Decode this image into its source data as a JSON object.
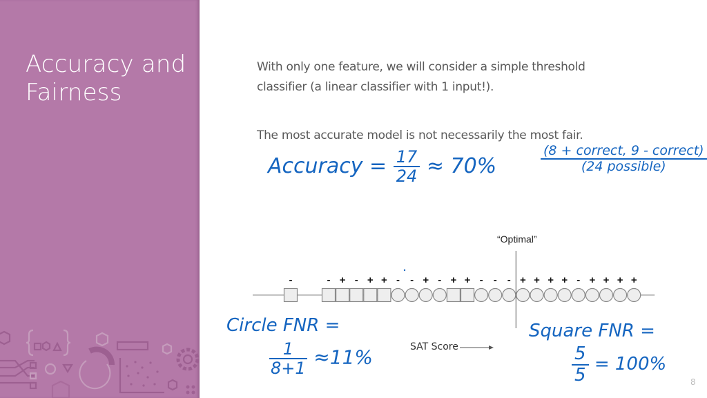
{
  "sidebar": {
    "title_line1": "Accuracy and",
    "title_line2": "Fairness",
    "color": "#b479a8"
  },
  "body": {
    "paragraph1_line1": "With only one feature, we will consider a simple threshold",
    "paragraph1_line2": "classifier (a linear classifier with 1 input!).",
    "paragraph2": "The most accurate model is not necessarily the most fair."
  },
  "annotations": {
    "ink_color": "#1565c0",
    "accuracy_label": "Accuracy =",
    "accuracy_numerator": "17",
    "accuracy_denominator": "24",
    "accuracy_result": "≈ 70%",
    "correct_note_numerator": "(8 + correct, 9 - correct)",
    "correct_note_denominator": "(24 possible)",
    "circle_fnr_label": "Circle FNR =",
    "circle_fnr_numerator": "1",
    "circle_fnr_denominator": "8+1",
    "circle_fnr_result": "≈11%",
    "square_fnr_label": "Square FNR =",
    "square_fnr_numerator": "5",
    "square_fnr_denominator": "5",
    "square_fnr_result": "= 100%"
  },
  "number_line": {
    "threshold_label": "“Optimal”",
    "axis_label": "SAT Score",
    "threshold_after_index": 14,
    "points": [
      {
        "shape": "square",
        "label": "-"
      },
      {
        "shape": "square",
        "label": "-"
      },
      {
        "shape": "square",
        "label": "+"
      },
      {
        "shape": "square",
        "label": "-"
      },
      {
        "shape": "square",
        "label": "+"
      },
      {
        "shape": "square",
        "label": "+"
      },
      {
        "shape": "circle",
        "label": "-"
      },
      {
        "shape": "circle",
        "label": "-"
      },
      {
        "shape": "circle",
        "label": "+"
      },
      {
        "shape": "circle",
        "label": "-"
      },
      {
        "shape": "square",
        "label": "+"
      },
      {
        "shape": "square",
        "label": "+"
      },
      {
        "shape": "circle",
        "label": "-"
      },
      {
        "shape": "circle",
        "label": "-"
      },
      {
        "shape": "circle",
        "label": "-"
      },
      {
        "shape": "circle",
        "label": "+"
      },
      {
        "shape": "circle",
        "label": "+"
      },
      {
        "shape": "circle",
        "label": "+"
      },
      {
        "shape": "circle",
        "label": "+"
      },
      {
        "shape": "circle",
        "label": "-"
      },
      {
        "shape": "circle",
        "label": "+"
      },
      {
        "shape": "circle",
        "label": "+"
      },
      {
        "shape": "circle",
        "label": "+"
      },
      {
        "shape": "circle",
        "label": "+"
      }
    ]
  },
  "page_number": "8"
}
